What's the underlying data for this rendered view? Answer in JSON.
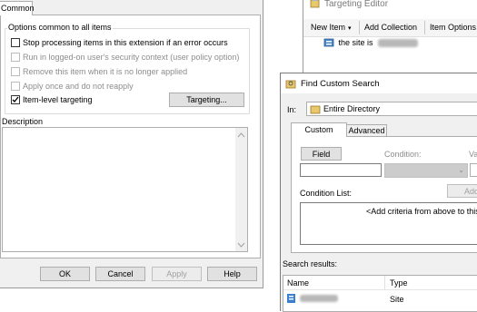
{
  "props": {
    "tab_common": "Common",
    "group_label": "Options common to all items",
    "options": [
      {
        "label": "Stop processing items in this extension if an error occurs",
        "checked": false,
        "enabled": true
      },
      {
        "label": "Run in logged-on user's security context (user policy option)",
        "checked": false,
        "enabled": false
      },
      {
        "label": "Remove this item when it is no longer applied",
        "checked": false,
        "enabled": false
      },
      {
        "label": "Apply once and do not reapply",
        "checked": false,
        "enabled": false
      },
      {
        "label": "Item-level targeting",
        "checked": true,
        "enabled": true
      }
    ],
    "targeting_button": "Targeting...",
    "description_label": "Description",
    "ok": "OK",
    "cancel": "Cancel",
    "apply": "Apply",
    "help": "Help"
  },
  "targeting": {
    "title": "Targeting Editor",
    "new_item": "New Item",
    "add_collection": "Add Collection",
    "item_options": "Item Options",
    "tree_item": "the site is"
  },
  "find": {
    "title": "Find Custom Search",
    "in_label": "In:",
    "in_value": "Entire Directory",
    "tab_custom": "Custom Search",
    "tab_advanced": "Advanced",
    "field_button": "Field",
    "condition_label": "Condition:",
    "value_label": "Va",
    "add_button": "Add",
    "condition_list_label": "Condition List:",
    "condition_placeholder": "<Add criteria from above to this lis",
    "results_label": "Search results:",
    "col_name": "Name",
    "col_type": "Type",
    "row_type": "Site"
  },
  "colors": {
    "dialog_bg": "#f0f0f0",
    "tab_bg": "#ffffff",
    "border": "#adadad",
    "blur": "#b8b8b8"
  }
}
